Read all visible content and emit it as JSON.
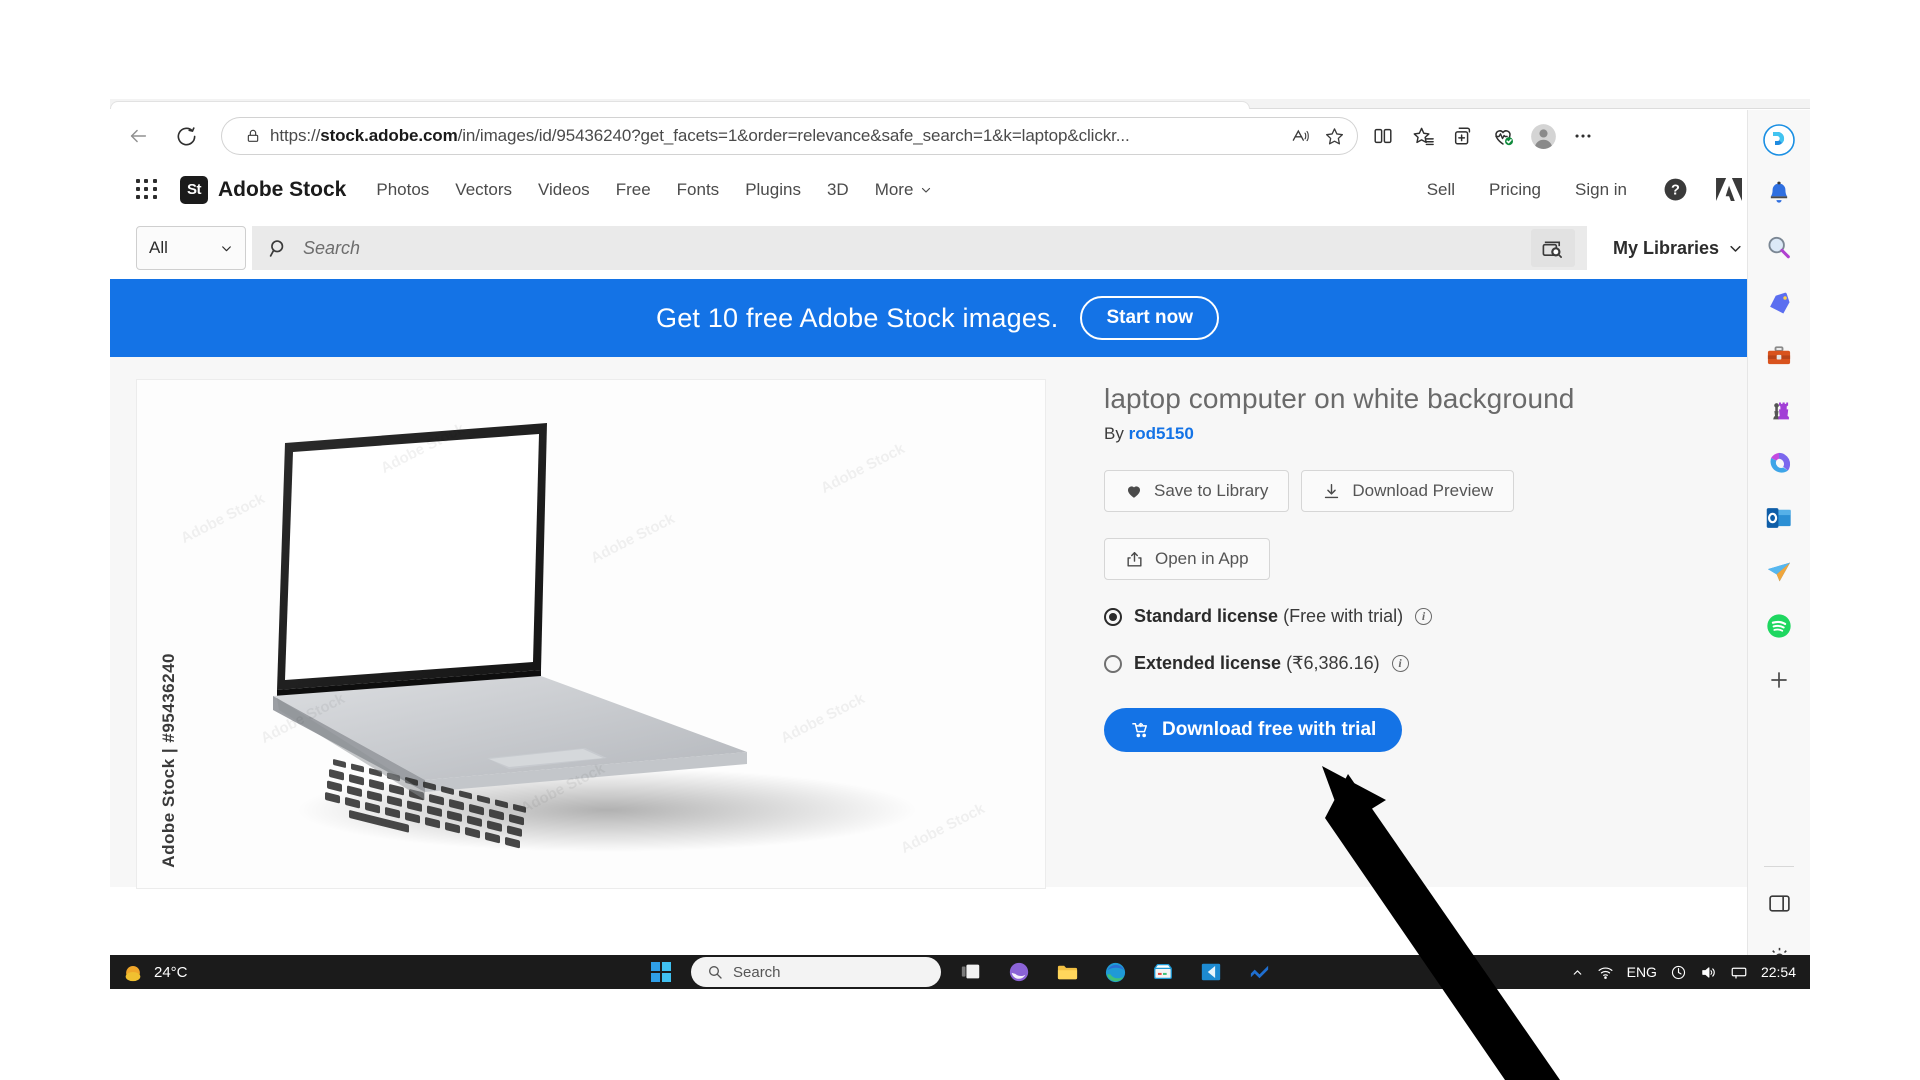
{
  "browser": {
    "back_label": "Back",
    "refresh_label": "Refresh",
    "url": "https://stock.adobe.com/in/images/id/95436240?get_facets=1&order=relevance&safe_search=1&k=laptop&clickr...",
    "url_domain": "stock.adobe.com",
    "url_prefix": "https://",
    "url_suffix": "/in/images/id/95436240?get_facets=1&order=relevance&safe_search=1&k=laptop&clickr...",
    "lock_icon": "lock-icon",
    "read_aloud_icon": "read-aloud-icon",
    "favorite_icon": "star-favorite-icon",
    "toolbar_icons": [
      {
        "name": "split-screen-icon",
        "label": "Split screen"
      },
      {
        "name": "favorites-icon",
        "label": "Favorites"
      },
      {
        "name": "collections-icon",
        "label": "Collections"
      },
      {
        "name": "browser-essentials-icon",
        "label": "Browser essentials"
      },
      {
        "name": "profile-avatar-icon",
        "label": "Profile"
      },
      {
        "name": "more-options-icon",
        "label": "Settings and more"
      }
    ]
  },
  "stock": {
    "logo_mark": "St",
    "logo_text": "Adobe Stock",
    "nav_links": [
      "Photos",
      "Vectors",
      "Videos",
      "Free",
      "Fonts",
      "Plugins",
      "3D"
    ],
    "nav_more": "More",
    "nav_right": [
      "Sell",
      "Pricing",
      "Sign in"
    ],
    "help_icon": "help-question-icon",
    "adobe_logo_icon": "adobe-logo-icon",
    "app_grid_icon": "app-grid-icon",
    "search": {
      "category_value": "All",
      "placeholder": "Search",
      "search_icon": "search-magnifier-icon",
      "visual_search_icon": "visual-search-camera-icon",
      "my_libraries": "My Libraries",
      "chevron_icon": "chevron-down-icon"
    },
    "promo": {
      "text": "Get 10 free Adobe Stock images.",
      "cta": "Start now",
      "bg_color": "#1473e6"
    },
    "asset": {
      "title": "laptop computer on white background",
      "by_prefix": "By",
      "author": "rod5150",
      "watermark": "Adobe Stock | #95436240",
      "watermark_tile": "Adobe Stock",
      "buttons": [
        {
          "label": "Save to Library",
          "icon": "heart-icon"
        },
        {
          "label": "Download Preview",
          "icon": "download-icon"
        },
        {
          "label": "Open in App",
          "icon": "open-in-app-icon"
        }
      ],
      "licenses": [
        {
          "name": "Standard license",
          "price": "(Free with trial)",
          "selected": true,
          "info_icon": "info-icon"
        },
        {
          "name": "Extended license",
          "price": "(₹6,386.16)",
          "selected": false,
          "info_icon": "info-icon"
        }
      ],
      "download_cta": "Download free with trial",
      "download_cta_icon": "cart-icon",
      "accent_color": "#1473e6"
    }
  },
  "sidebar": {
    "items": [
      {
        "name": "copilot-icon",
        "label": "Copilot"
      },
      {
        "name": "notifications-bell-icon",
        "label": "Notifications"
      },
      {
        "name": "search-icon",
        "label": "Search"
      },
      {
        "name": "shopping-tag-icon",
        "label": "Shopping"
      },
      {
        "name": "tools-briefcase-icon",
        "label": "Tools"
      },
      {
        "name": "games-icon",
        "label": "Games"
      },
      {
        "name": "microsoft-365-icon",
        "label": "Microsoft 365"
      },
      {
        "name": "outlook-icon",
        "label": "Outlook"
      },
      {
        "name": "mail-icon",
        "label": "Mail"
      },
      {
        "name": "spotify-icon",
        "label": "Spotify"
      },
      {
        "name": "add-sidebar-app-icon",
        "label": "Add"
      }
    ],
    "bottom": [
      {
        "name": "sidebar-toggle-icon",
        "label": "Toggle sidebar"
      },
      {
        "name": "sidebar-settings-gear-icon",
        "label": "Settings"
      }
    ]
  },
  "taskbar": {
    "weather_temp": "24°C",
    "weather_icon": "sun-weather-icon",
    "start_icon": "windows-start-icon",
    "search_placeholder": "Search",
    "apps": [
      {
        "name": "task-view-icon",
        "label": "Task view"
      },
      {
        "name": "edge-copilot-icon",
        "label": "Copilot"
      },
      {
        "name": "file-explorer-icon",
        "label": "File Explorer"
      },
      {
        "name": "microsoft-edge-icon",
        "label": "Microsoft Edge"
      },
      {
        "name": "microsoft-store-icon",
        "label": "Microsoft Store"
      },
      {
        "name": "vs-code-icon",
        "label": "Visual Studio Code"
      },
      {
        "name": "app-icon",
        "label": "App"
      }
    ],
    "tray": {
      "chevron_icon": "show-hidden-icons-icon",
      "wifi_icon": "wifi-icon",
      "language": "ENG",
      "battery_icon": "battery-icon",
      "volume_icon": "volume-icon",
      "network_icon": "network-icon",
      "clock": "22:54"
    }
  }
}
